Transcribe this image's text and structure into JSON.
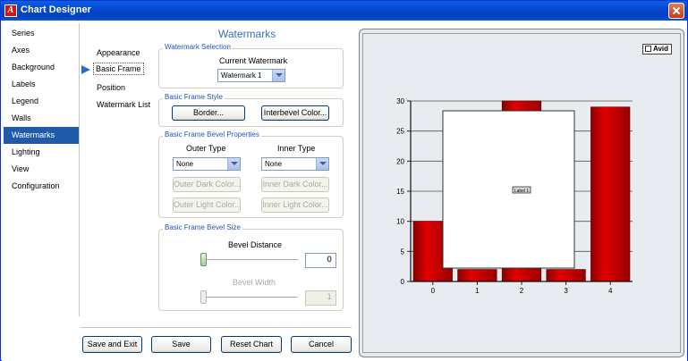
{
  "window": {
    "title": "Chart Designer",
    "icon": "app-a-icon"
  },
  "nav": {
    "items": [
      "Series",
      "Axes",
      "Background",
      "Labels",
      "Legend",
      "Walls",
      "Watermarks",
      "Lighting",
      "View",
      "Configuration"
    ],
    "active_index": 6
  },
  "subnav": {
    "items": [
      "Appearance",
      "Basic Frame",
      "Position",
      "Watermark List"
    ],
    "selected_index": 1
  },
  "panel": {
    "title": "Watermarks",
    "selection": {
      "group_label": "Watermark Selection",
      "current_label": "Current Watermark",
      "current_value": "Watermark 1"
    },
    "frame_style": {
      "group_label": "Basic Frame Style",
      "border_button": "Border...",
      "interbevel_button": "Interbevel Color..."
    },
    "bevel_props": {
      "group_label": "Basic Frame Bevel Properties",
      "outer_type_label": "Outer Type",
      "inner_type_label": "Inner Type",
      "outer_type_value": "None",
      "inner_type_value": "None",
      "outer_dark_button": "Outer Dark Color...",
      "inner_dark_button": "Inner Dark Color...",
      "outer_light_button": "Outer Light Color...",
      "inner_light_button": "Inner Light Color..."
    },
    "bevel_size": {
      "group_label": "Basic Frame Bevel Size",
      "distance_label": "Bevel Distance",
      "distance_value": "0",
      "width_label": "Bevel Width",
      "width_value": "1"
    }
  },
  "footer": {
    "save_exit": "Save and Exit",
    "save": "Save",
    "reset": "Reset Chart",
    "cancel": "Cancel"
  },
  "preview": {
    "legend_item": "Avid",
    "watermark_label": "Label 1",
    "bar_color": "#d40000"
  },
  "chart_data": {
    "type": "bar",
    "categories": [
      "0",
      "1",
      "2",
      "3",
      "4"
    ],
    "values": [
      10,
      2,
      30,
      2,
      29
    ],
    "ylim": [
      0,
      30
    ],
    "yticks": [
      0,
      5,
      10,
      15,
      20,
      25,
      30
    ],
    "grid": true,
    "series": [
      {
        "name": "Avid",
        "values": [
          10,
          2,
          30,
          2,
          29
        ]
      }
    ]
  }
}
